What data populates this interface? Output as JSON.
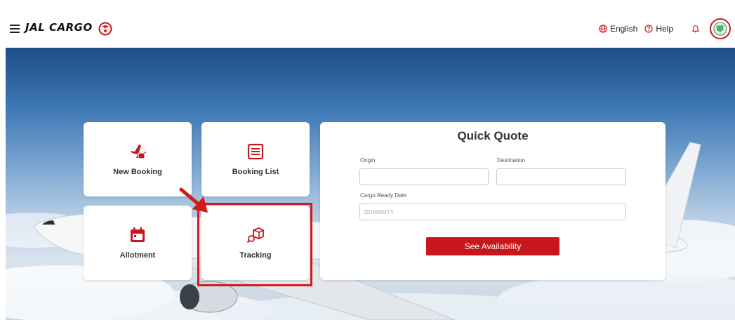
{
  "header": {
    "brand": "JAL CARGO",
    "language_label": "English",
    "help_label": "Help"
  },
  "tiles": {
    "new_booking": "New Booking",
    "booking_list": "Booking List",
    "allotment": "Allotment",
    "tracking": "Tracking"
  },
  "quick_quote": {
    "title": "Quick Quote",
    "origin_label": "Origin",
    "origin_value": "",
    "destination_label": "Destination",
    "destination_value": "",
    "cargo_ready_date_label": "Cargo Ready Date",
    "cargo_ready_date_value": "",
    "cargo_ready_date_placeholder": "DDMMMYY",
    "submit_label": "See Availability"
  },
  "colors": {
    "brand_red": "#c8161d",
    "highlight_red": "#d11a1a"
  },
  "icons": {
    "menu": "hamburger-menu-icon",
    "brand_logo": "tsurumaru-crane-logo",
    "language": "globe-icon",
    "help": "question-circle-icon",
    "notifications": "bell-icon",
    "avatar": "user-avatar",
    "new_booking": "plane-box-icon",
    "booking_list": "list-document-icon",
    "allotment": "calendar-icon",
    "tracking": "box-search-icon"
  }
}
